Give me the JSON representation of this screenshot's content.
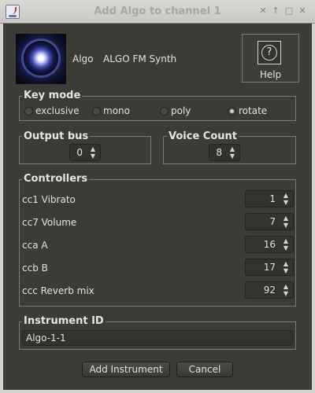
{
  "window": {
    "title": "Add Algo to channel 1",
    "controls": [
      "close-icon",
      "chevron-up-icon",
      "maximize-icon",
      "close-x-icon"
    ]
  },
  "instrument": {
    "short_name": "Algo",
    "full_name": "ALGO FM Synth",
    "icon": "glowing-orb-image"
  },
  "help": {
    "glyph": "?",
    "label": "Help"
  },
  "key_mode": {
    "title": "Key mode",
    "options": [
      "exclusive",
      "mono",
      "poly",
      "rotate"
    ],
    "selected": "rotate"
  },
  "output_bus": {
    "title": "Output bus",
    "value": "0"
  },
  "voice_count": {
    "title": "Voice Count",
    "value": "8"
  },
  "controllers": {
    "title": "Controllers",
    "items": [
      {
        "label": "cc1 Vibrato",
        "value": "1"
      },
      {
        "label": "cc7 Volume",
        "value": "7"
      },
      {
        "label": "cca A",
        "value": "16"
      },
      {
        "label": "ccb B",
        "value": "17"
      },
      {
        "label": "ccc Reverb mix",
        "value": "92"
      }
    ]
  },
  "instrument_id": {
    "title": "Instrument ID",
    "value": "Algo-1-1"
  },
  "buttons": {
    "add": "Add Instrument",
    "cancel": "Cancel"
  },
  "colors": {
    "background": "#3c3b36",
    "titlebar": "#d9d8d5",
    "text": "#e4e2dc",
    "border": "#7b7a74"
  }
}
